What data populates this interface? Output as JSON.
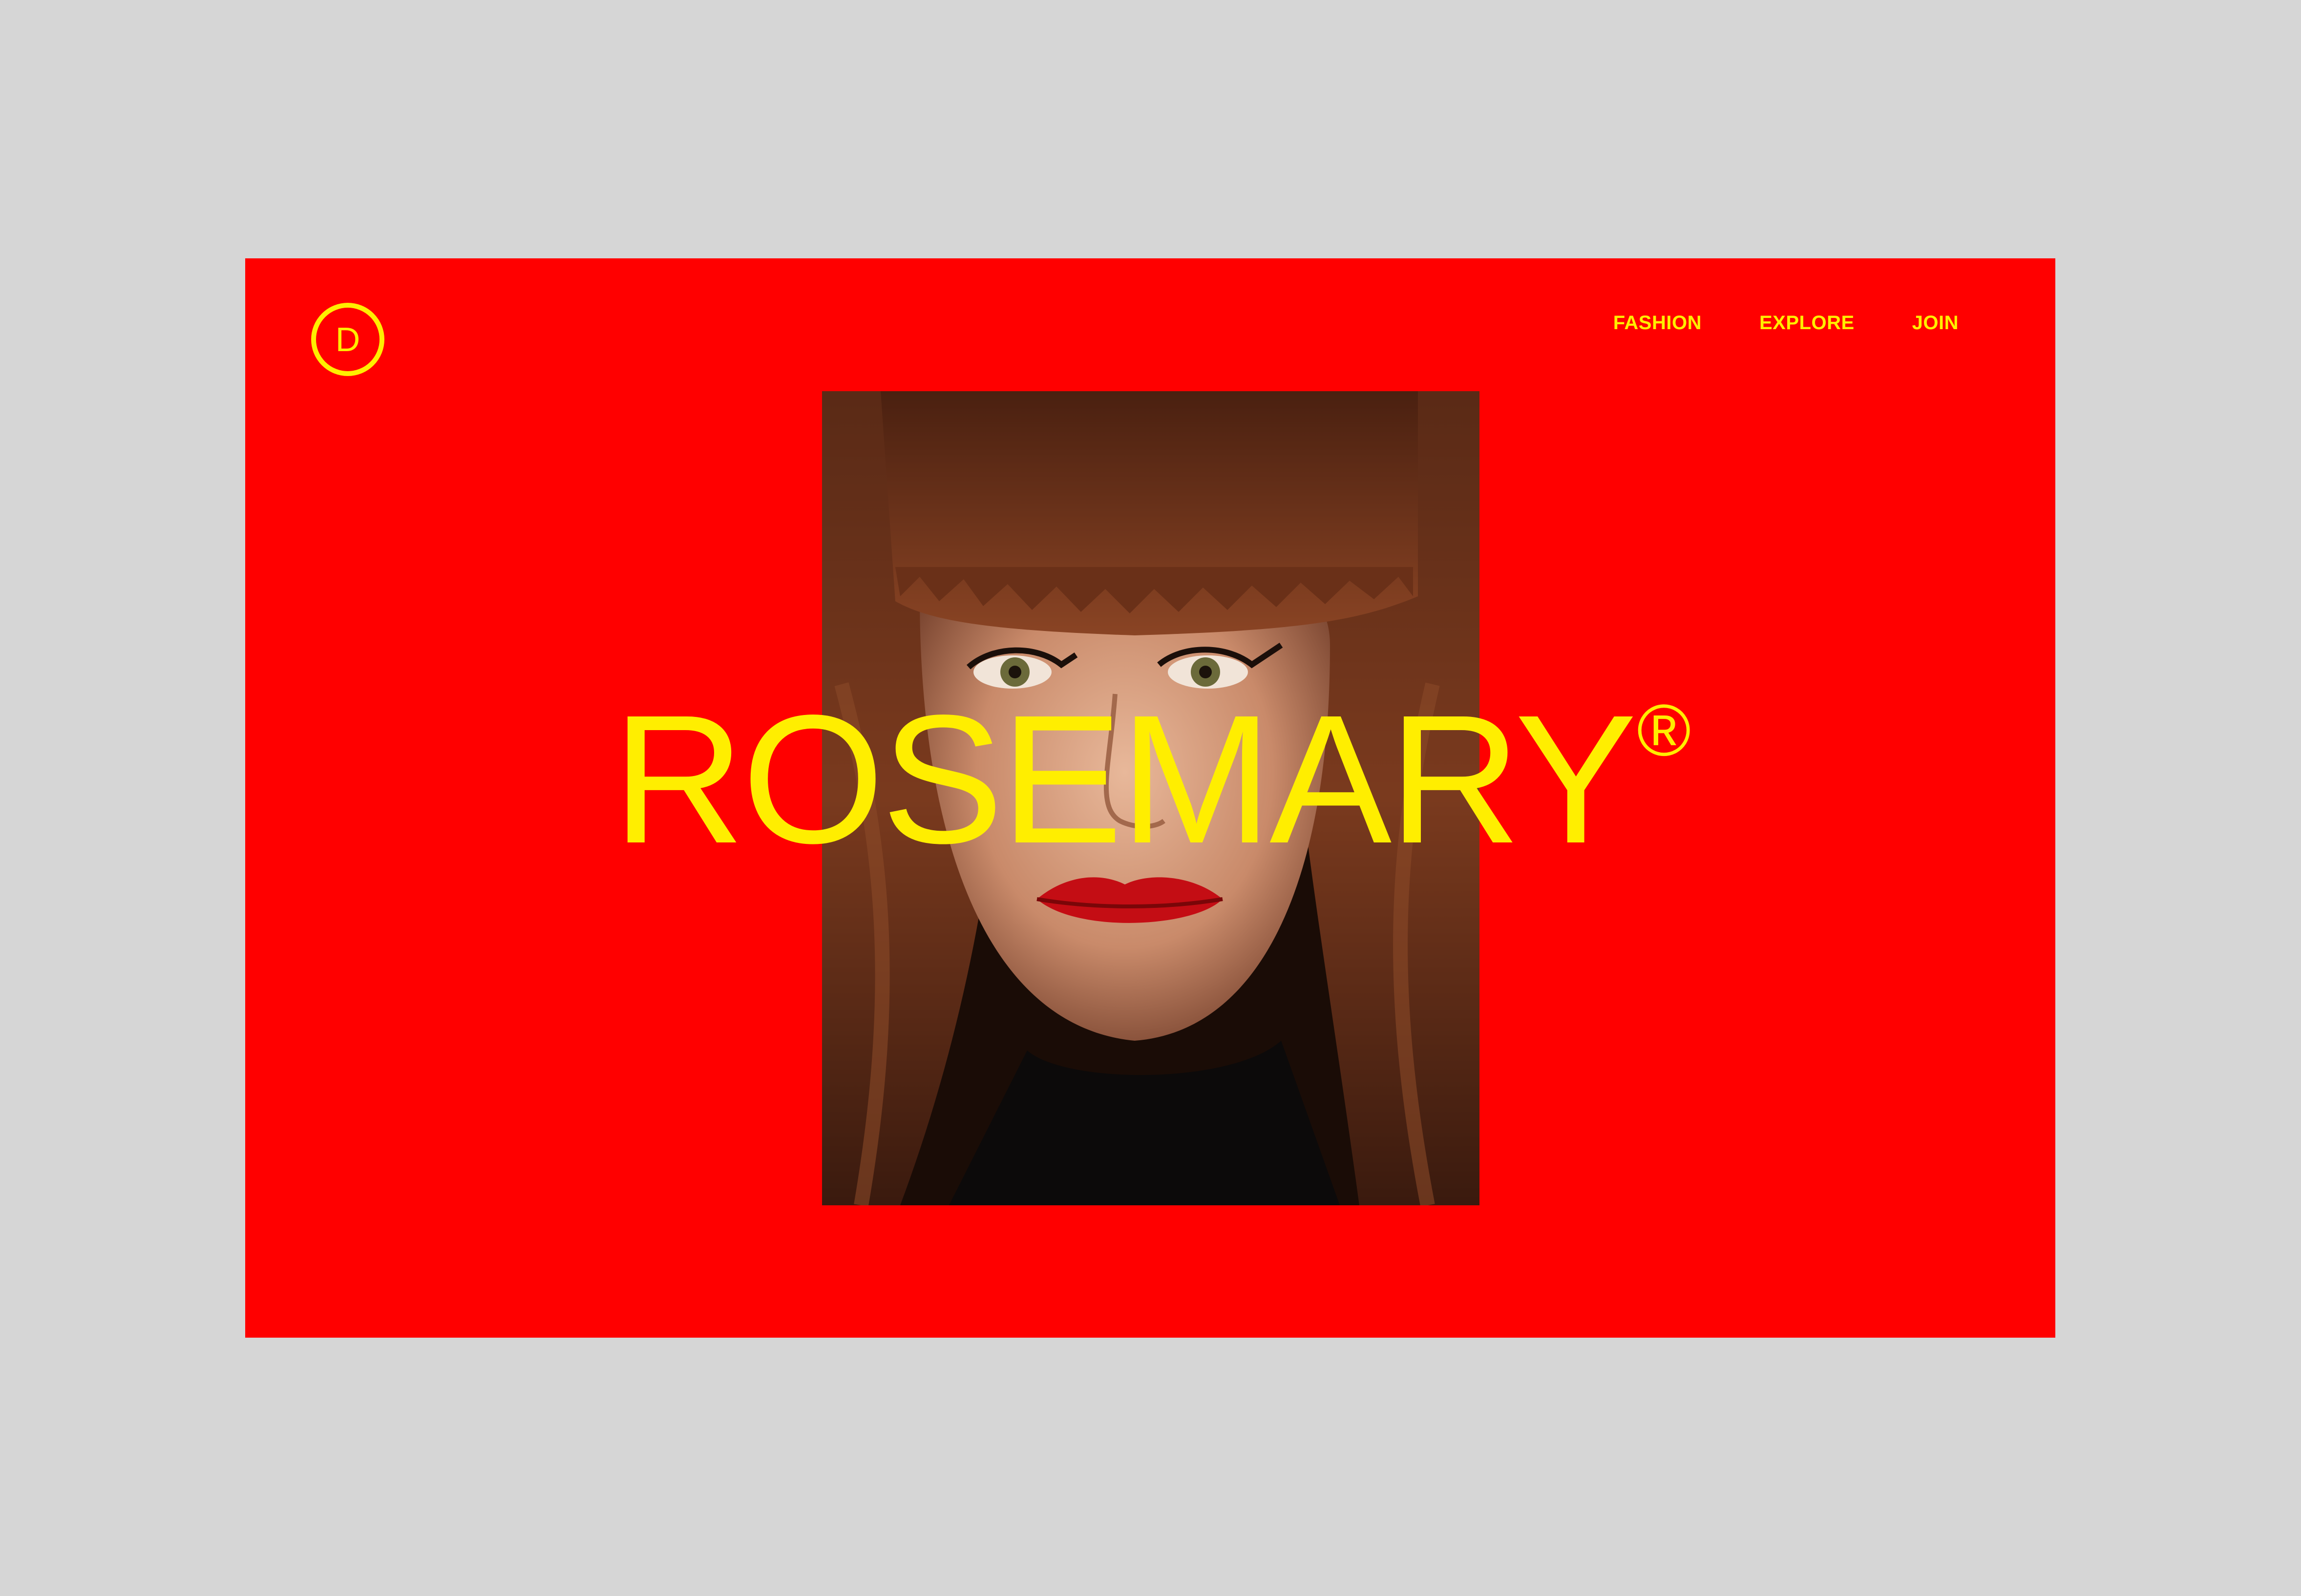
{
  "brand": {
    "logo_letter": "D"
  },
  "nav": {
    "items": [
      {
        "label": "FASHION"
      },
      {
        "label": "EXPLORE"
      },
      {
        "label": "JOIN"
      }
    ]
  },
  "hero": {
    "title": "ROSEMARY",
    "trademark": "®",
    "image_icon": "portrait-photo"
  },
  "colors": {
    "background": "#d6d6d6",
    "panel": "#ff0000",
    "accent": "#ffee00"
  }
}
